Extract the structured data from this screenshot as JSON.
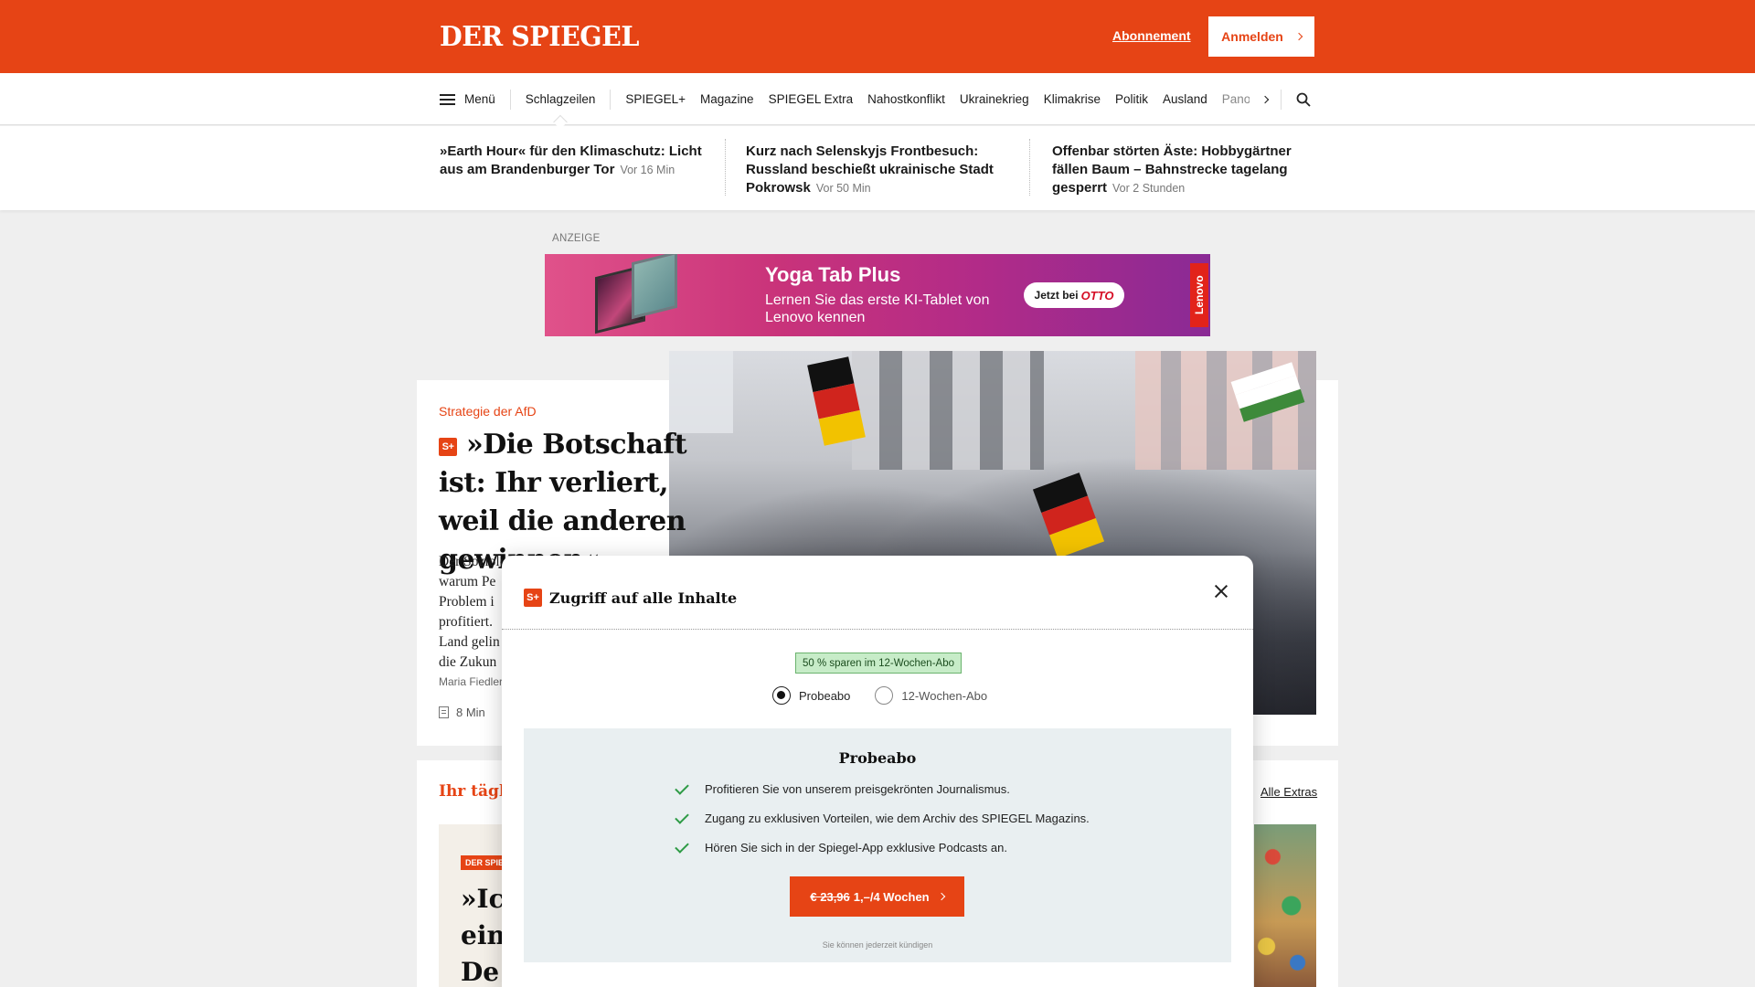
{
  "header": {
    "logo": "DER SPIEGEL",
    "abo_link": "Abonnement",
    "login_label": "Anmelden"
  },
  "nav": {
    "menu_label": "Menü",
    "items": [
      "Schlagzeilen",
      "SPIEGEL+",
      "Magazine",
      "SPIEGEL Extra",
      "Nahostkonflikt",
      "Ukrainekrieg",
      "Klimakrise",
      "Politik",
      "Ausland"
    ],
    "overflow_item": "Panorama"
  },
  "ticker": [
    {
      "headline": "»Earth Hour« für den Klimaschutz: Licht aus am Brandenburger Tor",
      "time": "Vor 16 Min"
    },
    {
      "headline": "Kurz nach Selenskyjs Frontbesuch: Russland beschießt ukrainische Stadt Pokrowsk",
      "time": "Vor 50 Min"
    },
    {
      "headline": "Offenbar störten Äste: Hobbygärtner fällen Baum – Bahnstrecke tagelang gesperrt",
      "time": "Vor 2 Stunden"
    }
  ],
  "ad": {
    "label": "ANZEIGE",
    "title": "Yoga Tab Plus",
    "subtitle": "Lernen Sie das erste KI-Tablet von Lenovo kennen",
    "cta_prefix": "Jetzt bei",
    "cta_brand": "OTTO",
    "brand": "Lenovo"
  },
  "lead": {
    "kicker": "Strategie der AfD",
    "splus": "S+",
    "headline": "»Die Botschaft ist: Ihr verliert, weil die anderen gewinnen«",
    "teaser_lines": [
      "Der Soziologe",
      "warum Pe",
      "Problem i",
      "profitiert.",
      "Land gelin",
      "die Zukun"
    ],
    "author": "Maria Fiedler",
    "read_time": "8 Min"
  },
  "section2": {
    "title": "Ihr täglich",
    "link": "Alle Extras",
    "badge": "DER SPIEGEL",
    "big_lines": [
      "»Ic",
      "ein",
      "De"
    ]
  },
  "modal": {
    "title": "Zugriff auf alle Inhalte",
    "splus": "S+",
    "save_badge": "50 % sparen im 12-Wochen-Abo",
    "options": [
      {
        "label": "Probeabo",
        "selected": true
      },
      {
        "label": "12-Wochen-Abo",
        "selected": false
      }
    ],
    "offer_title": "Probeabo",
    "benefits": [
      "Profitieren Sie von unserem preisgekrönten Journalismus.",
      "Zugang zu exklusiven Vorteilen, wie dem Archiv des SPIEGEL Magazins.",
      "Hören Sie sich in der Spiegel-App exklusive Podcasts an."
    ],
    "cta_old_price": "€ 23,96",
    "cta_new_price": "1,–/4 Wochen",
    "cancel_note": "Sie können jederzeit kündigen"
  },
  "colors": {
    "brand": "#e64415",
    "success": "#2e9b46",
    "offer_bg": "#e9eff1"
  }
}
